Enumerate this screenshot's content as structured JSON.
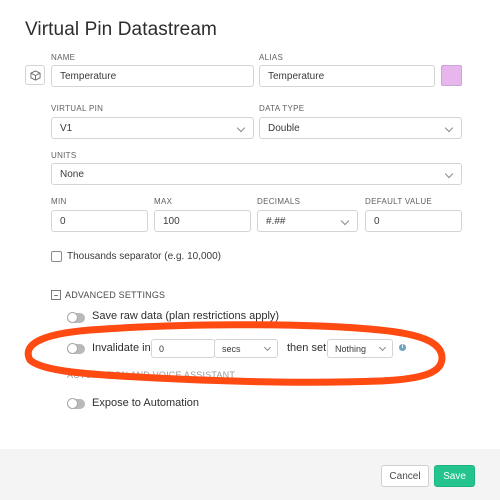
{
  "dialog": {
    "title": "Virtual Pin Datastream"
  },
  "fields": {
    "name": {
      "label": "NAME",
      "value": "Temperature"
    },
    "alias": {
      "label": "ALIAS",
      "value": "Temperature"
    },
    "alias_color": "#e6b6ec",
    "virtual_pin": {
      "label": "VIRTUAL PIN",
      "value": "V1"
    },
    "data_type": {
      "label": "DATA TYPE",
      "value": "Double"
    },
    "units": {
      "label": "UNITS",
      "value": "None"
    },
    "min": {
      "label": "MIN",
      "value": "0"
    },
    "max": {
      "label": "MAX",
      "value": "100"
    },
    "decimals": {
      "label": "DECIMALS",
      "value": "#.##"
    },
    "default_value": {
      "label": "DEFAULT VALUE",
      "value": "0"
    }
  },
  "thousands_separator": {
    "label": "Thousands separator (e.g. 10,000)",
    "checked": false
  },
  "advanced": {
    "heading": "ADVANCED SETTINGS",
    "save_raw": {
      "label": "Save raw data (plan restrictions apply)",
      "enabled": false
    },
    "invalidate": {
      "label": "Invalidate in",
      "value": "0",
      "unit": "secs",
      "then_set_label": "then set",
      "then_set_value": "Nothing",
      "enabled": false
    }
  },
  "automation": {
    "heading": "AUTOMATION AND VOICE ASSISTANT",
    "expose": {
      "label": "Expose to Automation",
      "enabled": false
    }
  },
  "footer": {
    "cancel_label": "Cancel",
    "save_label": "Save"
  },
  "colors": {
    "accent_green": "#23c48e",
    "annotation_orange": "#ff4a12",
    "info_blue": "#6fa3c2"
  },
  "icons": {
    "device_icon": "cube-icon",
    "info_icon": "info-icon",
    "dropdown_icon": "chevron-down-icon"
  }
}
